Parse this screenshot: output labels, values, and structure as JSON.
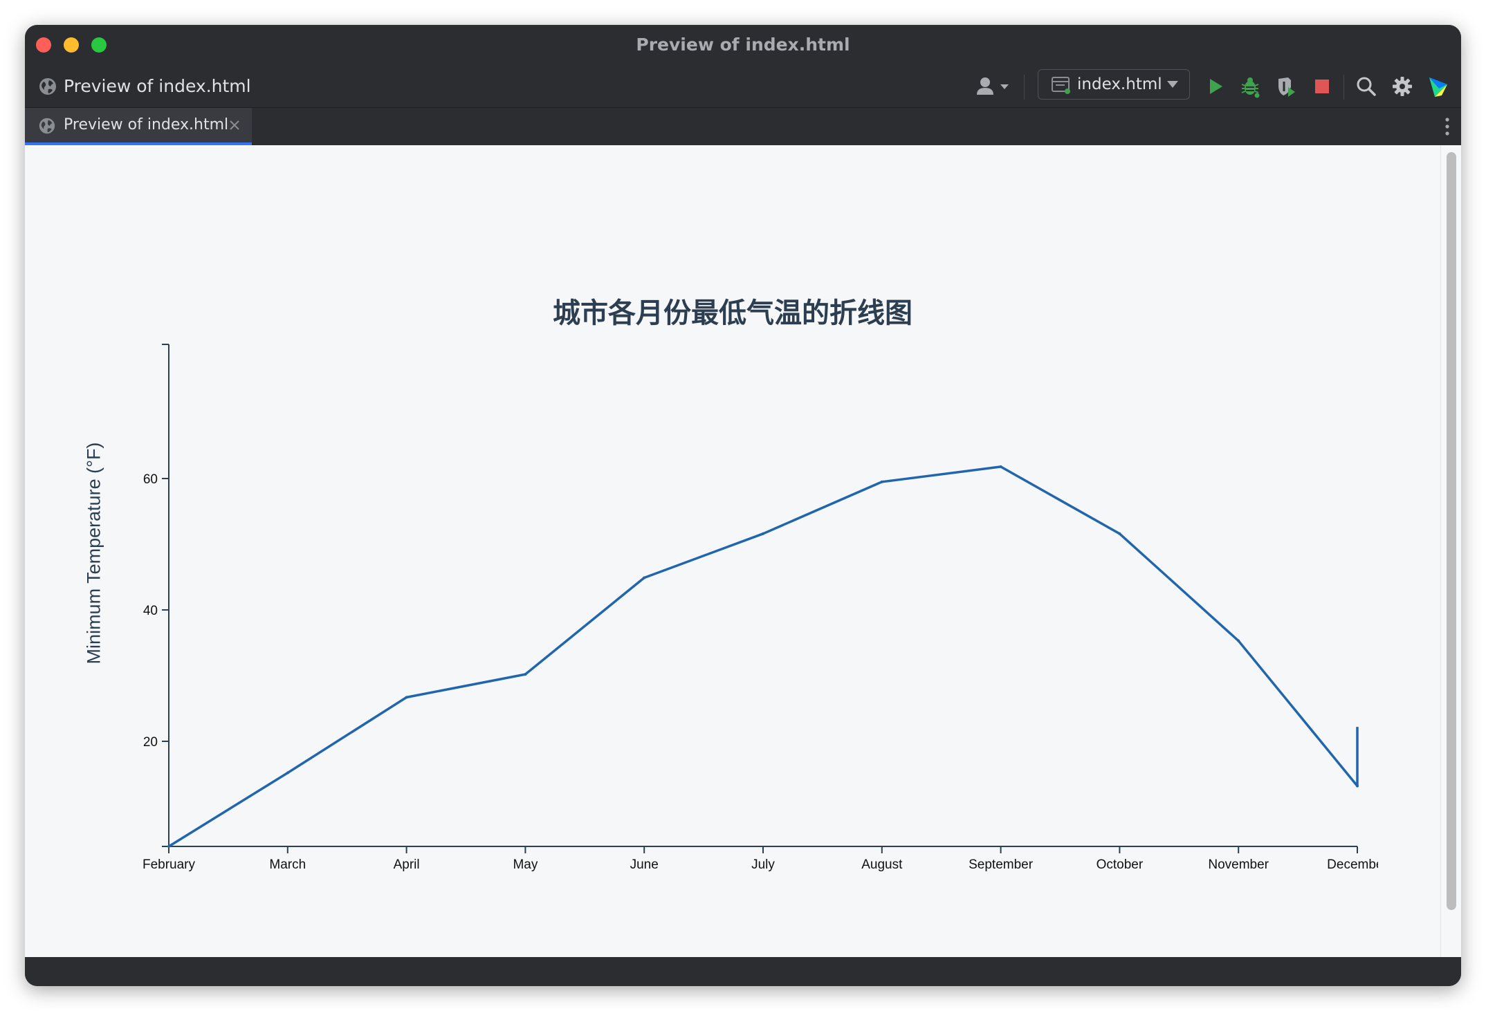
{
  "window": {
    "title": "Preview of index.html"
  },
  "toolbar": {
    "title": "Preview of index.html",
    "run_config_label": "index.html",
    "icons": [
      "user-icon",
      "run-icon",
      "debug-icon",
      "coverage-icon",
      "stop-icon",
      "search-icon",
      "gear-icon",
      "jetbrains-logo-icon"
    ]
  },
  "tabs": [
    {
      "label": "Preview of index.html",
      "active": true
    }
  ],
  "colors": {
    "line": "#2166ac",
    "title": "#2c3e50",
    "background": "#f5f7f9",
    "run": "#3fa34d",
    "stop": "#e05555",
    "tab_accent": "#3574f0"
  },
  "chart_data": {
    "type": "line",
    "title": "城市各月份最低气温的折线图",
    "xlabel": "",
    "ylabel": "Minimum Temperature (°F)",
    "categories": [
      "February",
      "March",
      "April",
      "May",
      "June",
      "July",
      "August",
      "September",
      "October",
      "November",
      "December"
    ],
    "series": [
      {
        "values": [
          4,
          15.2,
          26.7,
          30.2,
          44.9,
          51.6,
          59.5,
          61.8,
          51.6,
          35.3,
          13.2
        ]
      }
    ],
    "end_spike": [
      13.2,
      22.2
    ],
    "yticks": [
      20,
      40,
      60
    ],
    "ylim": [
      4,
      62
    ],
    "last_tick_label_display": "Decemb",
    "grid": false,
    "legend": "none"
  }
}
